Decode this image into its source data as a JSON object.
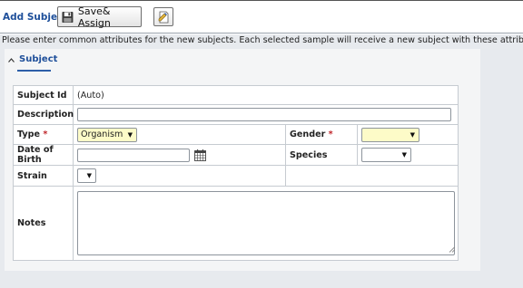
{
  "toolbar": {
    "title": "Add Subject",
    "save_label": "Save& Assign",
    "icons": {
      "save": "floppy-disk-icon",
      "note": "document-edit-icon"
    }
  },
  "instructions": "Please enter common attributes for the new subjects. Each selected sample will receive a new subject with these attributes.",
  "panel": {
    "title": "Subject",
    "caret_icon": "caret-up-icon"
  },
  "form": {
    "subject_id": {
      "label": "Subject Id",
      "value": "(Auto)"
    },
    "description": {
      "label": "Description",
      "value": ""
    },
    "type": {
      "label": "Type",
      "required_mark": "*",
      "selected": "Organism"
    },
    "gender": {
      "label": "Gender",
      "required_mark": "*",
      "selected": ""
    },
    "dob": {
      "label": "Date of Birth",
      "value": "",
      "icon": "calendar-icon"
    },
    "species": {
      "label": "Species",
      "selected": ""
    },
    "strain": {
      "label": "Strain",
      "selected": ""
    },
    "notes": {
      "label": "Notes",
      "value": ""
    }
  },
  "colors": {
    "accent": "#1e4f9a",
    "required": "#c0262b",
    "required_field_bg": "#fdfbc8",
    "background": "#e7eaee"
  }
}
